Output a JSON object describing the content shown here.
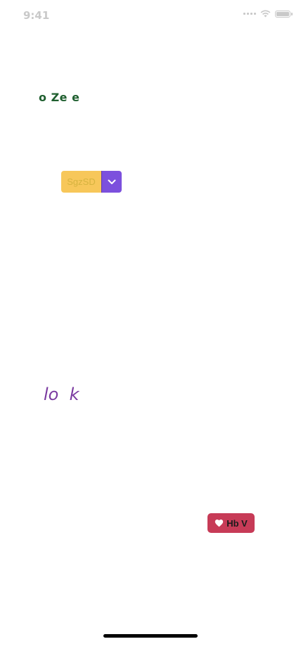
{
  "status_bar": {
    "time": "9:41",
    "icons": [
      "signal-icon",
      "wifi-icon",
      "battery-icon"
    ]
  },
  "heading": {
    "text": "o Ze e",
    "color": "#1f5f2f"
  },
  "split_button": {
    "label": "SgzSD",
    "main_color": "#f7c75a",
    "toggle_color": "#7c50dd",
    "toggle_icon": "chevron-down-icon"
  },
  "italic_text": {
    "text": "lo  k",
    "color": "#7a3aa0"
  },
  "like_button": {
    "label": "Hb V",
    "icon": "heart-icon",
    "color": "#c73b57"
  }
}
